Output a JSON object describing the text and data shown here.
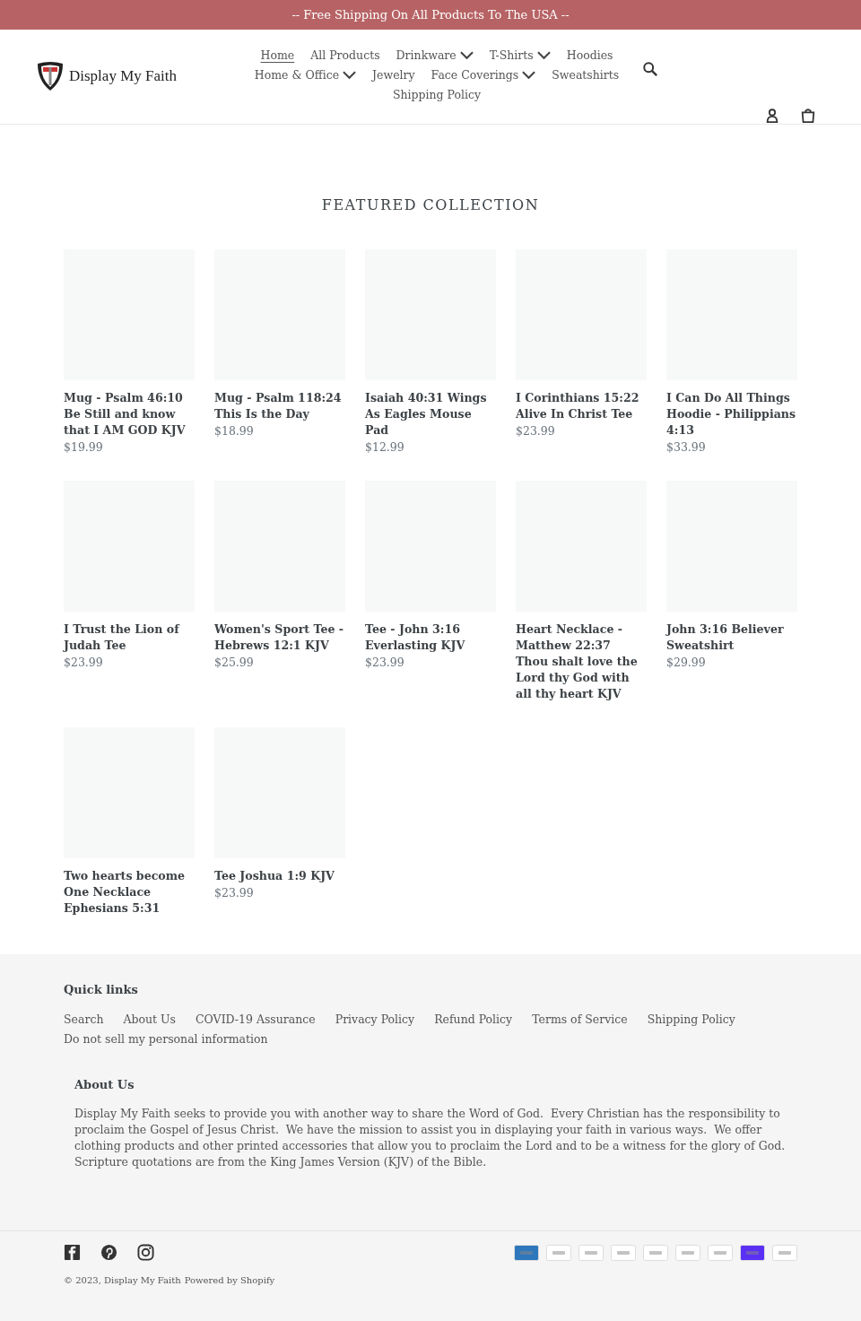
{
  "announcement": "-- Free Shipping On All Products To The USA --",
  "logo": {
    "text": "Display My Faith"
  },
  "nav": [
    {
      "label": "Home",
      "selected": true,
      "dropdown": false
    },
    {
      "label": "All Products",
      "selected": false,
      "dropdown": false
    },
    {
      "label": "Drinkware",
      "selected": false,
      "dropdown": true
    },
    {
      "label": "T-Shirts",
      "selected": false,
      "dropdown": true
    },
    {
      "label": "Hoodies",
      "selected": false,
      "dropdown": false
    },
    {
      "label": "Home & Office",
      "selected": false,
      "dropdown": true
    },
    {
      "label": "Jewelry",
      "selected": false,
      "dropdown": false
    },
    {
      "label": "Face Coverings",
      "selected": false,
      "dropdown": true
    },
    {
      "label": "Sweatshirts",
      "selected": false,
      "dropdown": false
    },
    {
      "label": "Shipping Policy",
      "selected": false,
      "dropdown": false
    }
  ],
  "section_title": "FEATURED COLLECTION",
  "products": [
    {
      "title": "Mug - Psalm 46:10 Be Still and know that I AM GOD KJV",
      "price": "$19.99"
    },
    {
      "title": "Mug - Psalm 118:24 This Is the Day",
      "price": "$18.99"
    },
    {
      "title": "Isaiah 40:31 Wings As Eagles Mouse Pad",
      "price": "$12.99"
    },
    {
      "title": "I Corinthians 15:22 Alive In Christ Tee",
      "price": "$23.99"
    },
    {
      "title": "I Can Do All Things Hoodie - Philippians 4:13",
      "price": "$33.99"
    },
    {
      "title": "I Trust the Lion of Judah Tee",
      "price": "$23.99"
    },
    {
      "title": "Women's Sport Tee - Hebrews 12:1 KJV",
      "price": "$25.99"
    },
    {
      "title": "Tee - John 3:16 Everlasting KJV",
      "price": "$23.99"
    },
    {
      "title": "Heart Necklace - Matthew 22:37 Thou shalt love the Lord thy God with all thy heart KJV"
    },
    {
      "title": "John 3:16 Believer Sweatshirt",
      "price": "$29.99"
    },
    {
      "title": "Two hearts become One Necklace Ephesians 5:31"
    },
    {
      "title": "Tee Joshua 1:9 KJV",
      "price": "$23.99"
    }
  ],
  "footer": {
    "quick_links_title": "Quick links",
    "links": [
      "Search",
      "About Us",
      "COVID-19 Assurance",
      "Privacy Policy",
      "Refund Policy",
      "Terms of Service",
      "Shipping Policy",
      "Do not sell my personal information"
    ],
    "about_title": "About Us",
    "about_text": "Display My Faith seeks to provide you with another way to share the Word of God.  Every Christian has the responsibility to proclaim the Gospel of Jesus Christ.  We have the mission to assist you in displaying your faith in various ways.  We offer clothing products and other printed accessories that allow you to proclaim the Lord and to be a witness for the glory of God.  Scripture quotations are from the King James Version (KJV) of the Bible.",
    "social": [
      {
        "kind": "facebook"
      },
      {
        "kind": "pinterest"
      },
      {
        "kind": "instagram"
      }
    ],
    "payments": [
      {
        "color": "#2e77bc"
      },
      {
        "color": "#ffffff"
      },
      {
        "color": "#ffffff"
      },
      {
        "color": "#ffffff"
      },
      {
        "color": "#ffffff"
      },
      {
        "color": "#ffffff"
      },
      {
        "color": "#ffffff"
      },
      {
        "color": "#5a31f4"
      },
      {
        "color": "#ffffff"
      }
    ],
    "copyright": "© 2023, Display My Faith",
    "powered": "Powered by Shopify"
  }
}
